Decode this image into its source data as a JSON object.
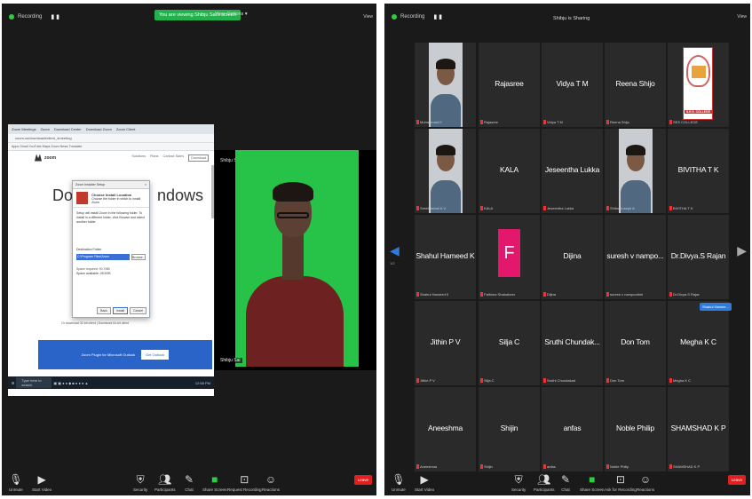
{
  "left": {
    "recording_label": "Recording",
    "pause_stop_glyph": "▮ ▮",
    "sharing_banner": "You are viewing Shibju Sai's screen",
    "view_options": "View Options ▾",
    "view_button": "View",
    "browser": {
      "tabs": [
        "Zoom Meetings",
        "Zoom",
        "Download Center",
        "Download Zoom",
        "Zoom Client"
      ],
      "url": "zoom.us/download#client_4meeting",
      "bookmarks": "Apps  Gmail  YouTube  Maps  Zoom  News  Translate"
    },
    "site": {
      "logo_text": "zoom",
      "nav": [
        "Solutions",
        "Plans",
        "Contact Sales",
        "Download"
      ],
      "title_left": "Downl",
      "title_right": "ndows"
    },
    "dialog": {
      "titlebar": "Zoom Installer Setup",
      "close": "×",
      "heading": "Choose Install Location",
      "subheading": "Choose the folder in which to install Zoom",
      "body": "Setup will install Zoom in the following folder. To install in a different folder, click Browse and select another folder.",
      "folder_label": "Destination Folder",
      "folder_path": "C:\\Program Files\\Zoom",
      "browse": "Browse...",
      "space_required": "Space required: 90.7MB",
      "space_available": "Space available: 28.5GB",
      "buttons": [
        "Back",
        "Install",
        "Cancel"
      ]
    },
    "download_links": "Or download 32-bit client  |  Download 64-bit client",
    "promo_text": "Zoom Plugin for Microsoft Outlook",
    "promo_button": "Get Outlook",
    "taskbar_search": "Type here to search",
    "taskbar_time": "12:58 PM",
    "speaker_name_top": "Shibju Sai",
    "speaker_name": "Shibju Sai",
    "toolbar": [
      {
        "icon": "mic-icon",
        "label": "Unmute"
      },
      {
        "icon": "video-icon",
        "label": "Start Video"
      },
      {
        "icon": "security-icon",
        "label": "Security"
      },
      {
        "icon": "participants-icon",
        "label": "Participants",
        "count": "37"
      },
      {
        "icon": "chat-icon",
        "label": "Chat"
      },
      {
        "icon": "share-screen-icon",
        "label": "Share Screen"
      },
      {
        "icon": "breakout-icon",
        "label": "Request Recording"
      },
      {
        "icon": "reactions-icon",
        "label": "Reactions"
      }
    ],
    "end_button": "Leave"
  },
  "right": {
    "recording_label": "Recording",
    "pause_stop_glyph": "▮ ▮",
    "sharing_label": "Shibju is Sharing",
    "view_button": "View",
    "page_indicator": "1/2",
    "raise_chip": "Shahul Hamee...",
    "tiles": [
      {
        "name": "",
        "label": "Muhammad K",
        "photo": true
      },
      {
        "name": "Rajasree",
        "label": "Rajasree"
      },
      {
        "name": "Vidya T M",
        "label": "Vidya T M"
      },
      {
        "name": "Reena Shijo",
        "label": "Reena Shijo"
      },
      {
        "name": "",
        "label": "SES COLLEGE",
        "logo": "S.E.S. COLLEGE"
      },
      {
        "name": "",
        "label": "Sreelekshmi A V",
        "photo": true
      },
      {
        "name": "KALA",
        "label": "KALA"
      },
      {
        "name": "Jeseentha Lukka",
        "label": "Jeseentha Lukka"
      },
      {
        "name": "",
        "label": "Shibu Joseph A",
        "photo": true
      },
      {
        "name": "BIVITHA T K",
        "label": "BIVITHA T K"
      },
      {
        "name": "Shahul Hameed K",
        "label": "Shahul Hameed K"
      },
      {
        "name": "",
        "label": "Fathima Shabaheer",
        "avatar": "F"
      },
      {
        "name": "Dijina",
        "label": "Dijina"
      },
      {
        "name": "suresh v nampo...",
        "label": "suresh v nampoothiri"
      },
      {
        "name": "Dr.Divya.S Rajan",
        "label": "Dr.Divya.S Rajan"
      },
      {
        "name": "Jithin P V",
        "label": "Jithin P V"
      },
      {
        "name": "Silja C",
        "label": "Silja C"
      },
      {
        "name": "Sruthi Chundak...",
        "label": "Sruthi Chundakad"
      },
      {
        "name": "Don Tom",
        "label": "Don Tom"
      },
      {
        "name": "Megha K C",
        "label": "Megha K C"
      },
      {
        "name": "Aneeshma",
        "label": "Aneeshma"
      },
      {
        "name": "Shijin",
        "label": "Shijin"
      },
      {
        "name": "anfas",
        "label": "anfas"
      },
      {
        "name": "Noble Philip",
        "label": "Noble Philip"
      },
      {
        "name": "SHAMSHAD K P",
        "label": "SHAMSHAD K P"
      }
    ],
    "toolbar": [
      {
        "icon": "mic-icon",
        "label": "Unmute"
      },
      {
        "icon": "video-icon",
        "label": "Start Video"
      },
      {
        "icon": "security-icon",
        "label": "Security"
      },
      {
        "icon": "participants-icon",
        "label": "Participants",
        "count": "34"
      },
      {
        "icon": "chat-icon",
        "label": "Chat"
      },
      {
        "icon": "share-screen-icon",
        "label": "Share Screen"
      },
      {
        "icon": "breakout-icon",
        "label": "Ask for Recording"
      },
      {
        "icon": "reactions-icon",
        "label": "Reactions"
      }
    ],
    "end_button": "Leave"
  }
}
